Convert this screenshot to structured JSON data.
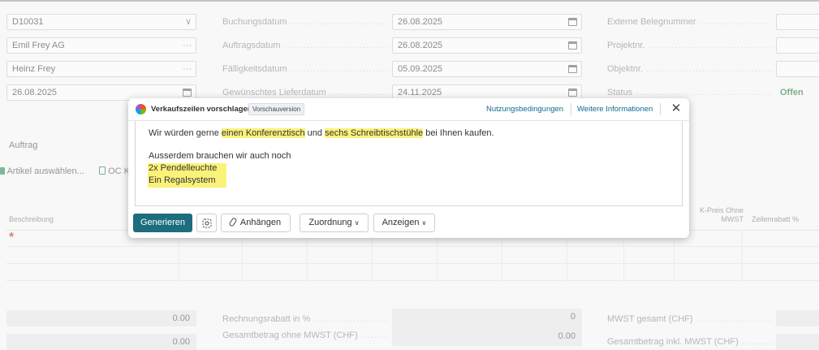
{
  "left_fields": [
    {
      "value": "D10031",
      "suffix": "∨"
    },
    {
      "value": "Emil Frey AG",
      "suffix": "···"
    },
    {
      "value": "Heinz Frey",
      "suffix": "···"
    },
    {
      "value": "26.08.2025",
      "suffix": "cal"
    }
  ],
  "mid_labels": [
    "Buchungsdatum",
    "Auftragsdatum",
    "Fälligkeitsdatum",
    "Gewünschtes Lieferdatum"
  ],
  "mid_values": [
    "26.08.2025",
    "26.08.2025",
    "05.09.2025",
    "24.11.2025"
  ],
  "right_labels": [
    "Externe Belegnummer",
    "Projektnr.",
    "Objektnr.",
    "Status"
  ],
  "status_value": "Offen",
  "section_title": "Auftrag",
  "actions": {
    "select_items": "Artikel auswählen...",
    "oc": "OC K"
  },
  "grid": {
    "col_description": "Beschreibung",
    "col_vk_price": "K-Preis Ohne MWST",
    "col_line_discount": "Zeilenrabatt %",
    "required_marker": "*"
  },
  "totals": {
    "left_values": [
      "0.00",
      "0.00"
    ],
    "mid_labels": [
      "Rechnungsrabatt in %",
      "Gesamtbetrag ohne MWST (CHF)"
    ],
    "mid_values": [
      "0",
      "0.00"
    ],
    "right_labels": [
      "MWST gesamt (CHF)",
      "Gesamtbetrag inkl. MWST (CHF)"
    ]
  },
  "dialog": {
    "title": "Verkaufszeilen vorschlagen",
    "badge": "Vorschauversion",
    "link_terms": "Nutzungsbedingungen",
    "link_info": "Weitere Informationen",
    "close": "✕",
    "text": {
      "line1_a": "Wir würden gerne ",
      "line1_b": "einen Konferenztisch",
      "line1_c": " und ",
      "line1_d": "sechs Schreibtischstühle",
      "line1_e": " bei Ihnen kaufen.",
      "line2": "Ausserdem brauchen wir auch noch",
      "line3": "2x Pendelleuchte",
      "line4": "Ein Regalsystem"
    },
    "btn_generate": "Generieren",
    "btn_attach": "Anhängen",
    "btn_mapping": "Zuordnung",
    "btn_view": "Anzeigen"
  },
  "colors": {
    "primary": "#1d6d7e",
    "highlight": "#fbf27a",
    "status": "#2f7d3a"
  }
}
